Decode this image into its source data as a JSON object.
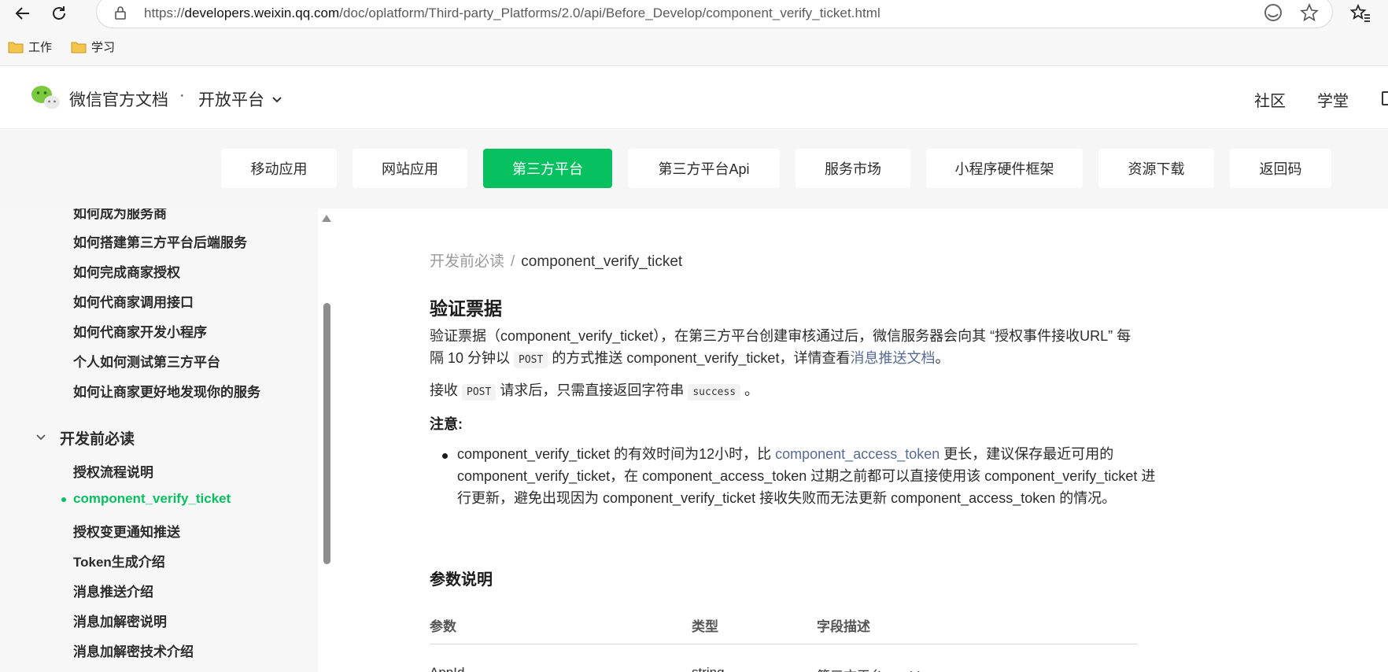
{
  "browser": {
    "url_prefix": "https://",
    "url_domain": "developers.weixin.qq.com",
    "url_path": "/doc/oplatform/Third-party_Platforms/2.0/api/Before_Develop/component_verify_ticket.html"
  },
  "bookmarks": [
    {
      "label": "工作"
    },
    {
      "label": "学习"
    }
  ],
  "header": {
    "site_title": "微信官方文档",
    "separator": "·",
    "platform": "开放平台",
    "links": [
      "社区",
      "学堂"
    ]
  },
  "tabs": [
    {
      "label": "移动应用"
    },
    {
      "label": "网站应用"
    },
    {
      "label": "第三方平台"
    },
    {
      "label": "第三方平台Api"
    },
    {
      "label": "服务市场"
    },
    {
      "label": "小程序硬件框架"
    },
    {
      "label": "资源下载"
    },
    {
      "label": "返回码"
    }
  ],
  "active_tab": "第三方平台",
  "sidebar": {
    "items_before": [
      "如何成为服务商",
      "如何搭建第三方平台后端服务",
      "如何完成商家授权",
      "如何代商家调用接口",
      "如何代商家开发小程序",
      "个人如何测试第三方平台",
      "如何让商家更好地发现你的服务"
    ],
    "group_label": "开发前必读",
    "group_items": [
      "授权流程说明",
      "component_verify_ticket",
      "授权变更通知推送",
      "Token生成介绍",
      "消息推送介绍",
      "消息加解密说明",
      "消息加解密技术介绍"
    ],
    "active_item": "component_verify_ticket"
  },
  "content": {
    "breadcrumb_parent": "开发前必读",
    "breadcrumb_sep": "/",
    "breadcrumb_current": "component_verify_ticket",
    "title": "验证票据",
    "p1_a": "验证票据（component_verify_ticket），在第三方平台创建审核通过后，微信服务器会向其 “授权事件接收URL” 每隔 10 分钟以 ",
    "p1_code": "POST",
    "p1_b": " 的方式推送 component_verify_ticket，详情查看",
    "p1_link": "消息推送文档",
    "p1_end": "。",
    "p2_a": "接收 ",
    "p2_code1": "POST",
    "p2_b": " 请求后，只需直接返回字符串 ",
    "p2_code2": "success",
    "p2_end": " 。",
    "note_label": "注意:",
    "bullet_a": "component_verify_ticket 的有效时间为12小时，比 ",
    "bullet_link": "component_access_token",
    "bullet_b": " 更长，建议保存最近可用的 component_verify_ticket，在 component_access_token 过期之前都可以直接使用该 component_verify_ticket 进行更新，避免出现因为 component_verify_ticket 接收失败而无法更新 component_access_token 的情况。",
    "params_title": "参数说明",
    "table_headers": [
      "参数",
      "类型",
      "字段描述"
    ],
    "first_row": [
      "AppId",
      "string",
      "第三方平台 appid"
    ]
  },
  "colors": {
    "brand_green": "#07c160",
    "link": "#576b95",
    "sidebar_bg": "#f7f7f7",
    "tabs_band_bg": "#f6f6f6"
  },
  "icons": [
    "back-icon",
    "reload-icon",
    "lock-icon",
    "edge-icon",
    "star-icon",
    "favorites-icon",
    "folder-icon",
    "wechat-logo-icon",
    "chevron-down-icon"
  ]
}
